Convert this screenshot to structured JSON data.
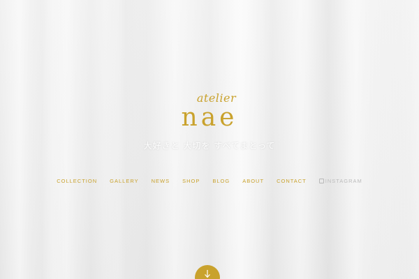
{
  "brand": {
    "sub": "atelier",
    "main": "nae"
  },
  "tagline": "大好きと 大切を すべてまとって",
  "nav": {
    "items": [
      {
        "label": "COLLECTION"
      },
      {
        "label": "GALLERY"
      },
      {
        "label": "NEWS"
      },
      {
        "label": "SHOP"
      },
      {
        "label": "BLOG"
      },
      {
        "label": "ABOUT"
      },
      {
        "label": "CONTACT"
      }
    ],
    "instagram": "INSTAGRAM"
  },
  "icons": {
    "scroll": "arrow-down-icon",
    "instagram": "instagram-icon"
  },
  "colors": {
    "accent": "#c9a22d",
    "muted": "#bcbcbc",
    "background": "#eeeeee"
  }
}
